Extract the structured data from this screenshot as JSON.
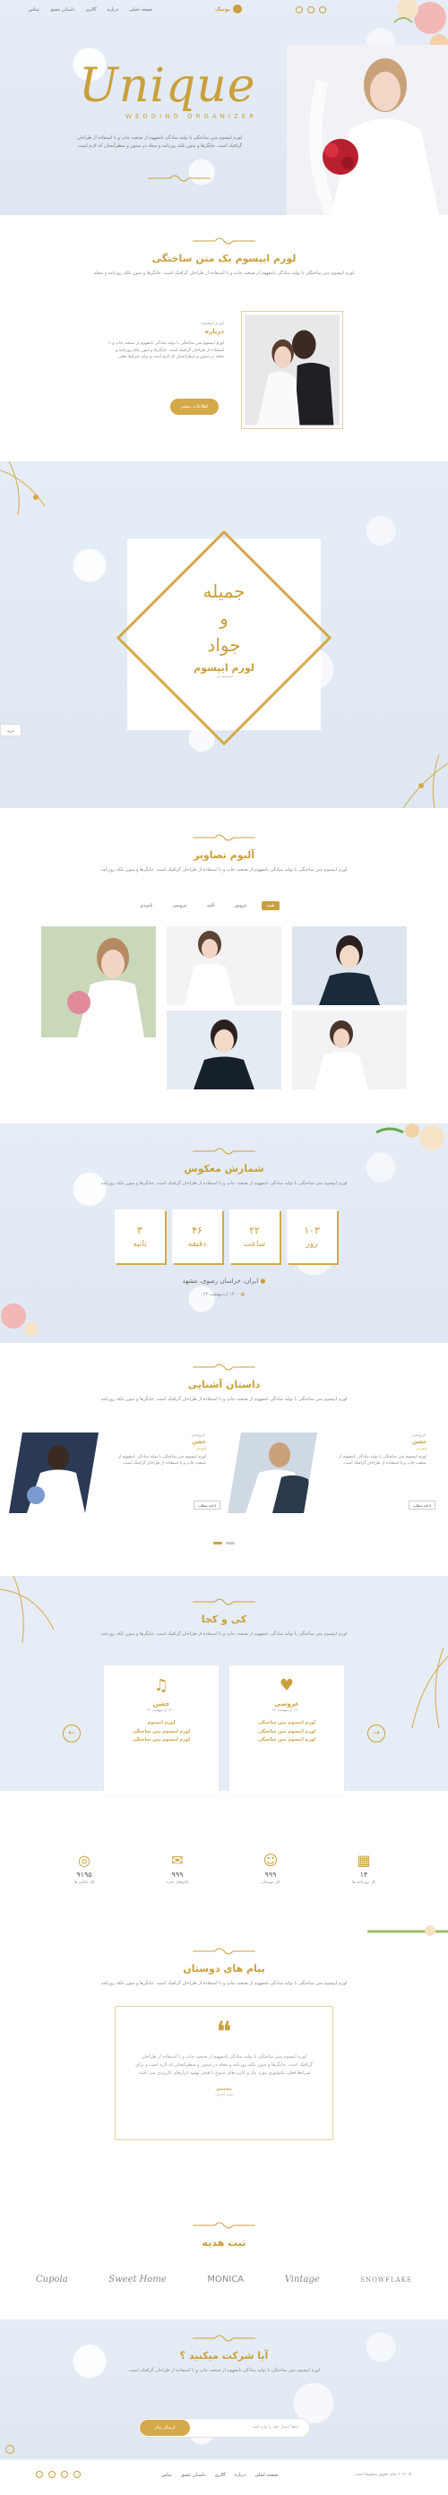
{
  "header": {
    "logo": "یونیک",
    "nav": [
      "صفحه اصلی",
      "درباره",
      "گالری",
      "داستان عشق",
      "تماس"
    ],
    "hero_title": "Unique",
    "hero_sub": "WEDDING ORGANIZER",
    "hero_text": "لورم ایپسوم متن ساختگی با تولید سادگی نامفهوم از صنعت چاپ و با استفاده از طراحان گرافیک است. چاپگرها و متون بلکه روزنامه و مجله در ستون و سطرآنچنان که لازم است."
  },
  "about": {
    "title": "لورم ایپسوم یک متن ساختگی",
    "desc": "لورم ایپسوم متن ساختگی با تولید سادگی نامفهوم از صنعت چاپ و با استفاده از طراحان گرافیک است. چاپگرها و متون بلکه روزنامه و مجله",
    "sub": "لورم ایپسوم",
    "heading": "درباره",
    "body": "لورم ایپسوم متن ساختگی با تولید سادگی نامفهوم از صنعت چاپ و با استفاده از طراحان گرافیک است. چاپگرها و متون بلکه روزنامه و مجله در ستون و سطرآنچنان که لازم است و برای شرایط فعلی.",
    "button": "اطلاعات بیشتر"
  },
  "couple": {
    "bride": "جمیله",
    "and": "و",
    "groom": "جواد",
    "caption": "لورم ایپسوم",
    "note": "ایپسوم متن",
    "side_tab": "خرید"
  },
  "gallery": {
    "title": "آلبوم تصاویر",
    "desc": "لورم ایپسوم متن ساختگی با تولید سادگی نامفهوم از صنعت چاپ و با استفاده از طراحان گرافیک است. چاپگرها و متون بلکه روزنامه",
    "filters": [
      "همه",
      "عروس",
      "آتلیه",
      "عروسی",
      "نامزدی"
    ]
  },
  "countdown": {
    "title": "شمارش معکوس",
    "desc": "لورم ایپسوم متن ساختگی با تولید سادگی نامفهوم از صنعت چاپ و با استفاده از طراحان گرافیک است. چاپگرها و متون بلکه روزنامه",
    "boxes": [
      {
        "v": "۱۰۳",
        "l": "روز"
      },
      {
        "v": "۲۲",
        "l": "ساعت"
      },
      {
        "v": "۴۶",
        "l": "دقیقه"
      },
      {
        "v": "۳",
        "l": "ثانیه"
      }
    ],
    "address": "ایران، خراسان رضوی، مشهد",
    "date": "۱۴۰۰ اردیبهشت ۲۲"
  },
  "story": {
    "title": "داستان آشنایی",
    "desc": "لورم ایپسوم متن ساختگی با تولید سادگی نامفهوم از صنعت چاپ و با استفاده از طراحان گرافیک است. چاپگرها و متون بلکه روزنامه",
    "items": [
      {
        "s": "عروسی",
        "t": "جشن",
        "sub": "نامزدی",
        "p": "لورم ایپسوم متن ساختگی با تولید سادگی نامفهوم از صنعت چاپ و با استفاده از طراحان گرافیک است.",
        "btn": "ادامه مطلب"
      },
      {
        "s": "عروسی",
        "t": "جشن",
        "sub": "نامزدی",
        "p": "لورم ایپسوم متن ساختگی با تولید سادگی نامفهوم از صنعت چاپ و با استفاده از طراحان گرافیک است.",
        "btn": "ادامه مطلب"
      }
    ]
  },
  "where": {
    "title": "کی و کجا",
    "desc": "لورم ایپسوم متن ساختگی با تولید سادگی نامفهوم از صنعت چاپ و با استفاده از طراحان گرافیک است. چاپگرها و متون بلکه روزنامه",
    "cards": [
      {
        "h": "عروسی",
        "d": "۱۴۰۰ اردیبهشت ۲۲",
        "lines": [
          "لورم ایپسوم متن ساختگی",
          "لورم ایپسوم متن ساختگی",
          "لورم ایپسوم متن ساختگی"
        ]
      },
      {
        "h": "جشن",
        "d": "۱۴۰۰ اردیبهشت ۲۲",
        "lines": [
          "لورم ایپسوم",
          "لورم ایپسوم متن ساختگی",
          "لورم ایپسوم متن ساختگی"
        ]
      }
    ],
    "stats": [
      {
        "v": "۱۴",
        "l": "کل روزنامه ها"
      },
      {
        "v": "۹۹۹",
        "l": "کل مهمانان"
      },
      {
        "v": "۹۹۹",
        "l": "کادوهای جدید"
      },
      {
        "v": "۹۱۹۵",
        "l": "کل عکس ها"
      }
    ]
  },
  "testi": {
    "title": "پیام های دوستان",
    "desc": "لورم ایپسوم متن ساختگی با تولید سادگی نامفهوم از صنعت چاپ و با استفاده از طراحان گرافیک است. چاپگرها و متون بلکه روزنامه",
    "quote": "لورم ایپسوم متن ساختگی با تولید سادگی نامفهوم از صنعت چاپ و با استفاده از طراحان گرافیک است. چاپگرها و متون بلکه روزنامه و مجله در ستون و سطرآنچنان که لازم است و برای شرایط فعلی تکنولوژی مورد نیاز و کاربردهای متنوع با هدف بهبود ابزارهای کاربردی می باشد.",
    "name": "محمدی",
    "role": "مدیر اجرایی"
  },
  "gifts": {
    "title": "ثبت هدیه",
    "brands": [
      "Cupola",
      "Sweet Home",
      "MONICA",
      "Vintage",
      "SNOWFLAKE"
    ]
  },
  "join": {
    "title": "آیا شرکت میکنید ؟",
    "desc": "لورم ایپسوم متن ساختگی با تولید سادگی نامفهوم از صنعت چاپ و با استفاده از طراحان گرافیک است.",
    "placeholder": "لطفاً ایمیل خود را وارد کنید",
    "button": "ارسال پیام"
  },
  "footer": {
    "copy": "© ۲۰۲۱ تمام حقوق محفوظ است",
    "nav": [
      "صفحه اصلی",
      "درباره",
      "گالری",
      "داستان عشق",
      "تماس"
    ]
  },
  "colors": {
    "accent": "#c9a03c",
    "bg": "#e6edf6"
  }
}
